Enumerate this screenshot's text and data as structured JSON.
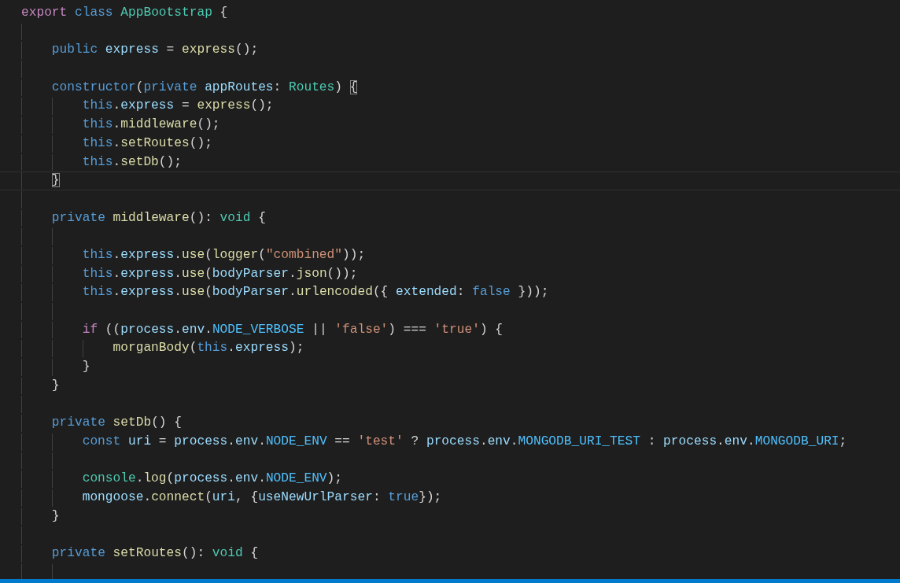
{
  "editor": {
    "lines": [
      {
        "kind": "code",
        "tokens": [
          {
            "kind": "control",
            "text": "export "
          },
          {
            "kind": "keyword",
            "text": "class "
          },
          {
            "kind": "type",
            "text": "AppBootstrap"
          },
          {
            "kind": "plain",
            "text": " {"
          }
        ],
        "children": [
          {
            "kind": "blank"
          },
          {
            "kind": "code",
            "tokens": [
              {
                "kind": "keyword",
                "text": "public "
              },
              {
                "kind": "variable",
                "text": "express"
              },
              {
                "kind": "plain",
                "text": " = "
              },
              {
                "kind": "function",
                "text": "express"
              },
              {
                "kind": "plain",
                "text": "();"
              }
            ]
          },
          {
            "kind": "blank"
          },
          {
            "kind": "code",
            "tokens": [
              {
                "kind": "keyword",
                "text": "constructor"
              },
              {
                "kind": "plain",
                "text": "("
              },
              {
                "kind": "keyword",
                "text": "private "
              },
              {
                "kind": "variable",
                "text": "appRoutes"
              },
              {
                "kind": "plain",
                "text": ": "
              },
              {
                "kind": "type",
                "text": "Routes"
              },
              {
                "kind": "plain",
                "text": ") "
              },
              {
                "kind": "plain",
                "text": "{",
                "bracket_match": true
              }
            ],
            "children": [
              {
                "kind": "code",
                "tokens": [
                  {
                    "kind": "keyword",
                    "text": "this"
                  },
                  {
                    "kind": "plain",
                    "text": "."
                  },
                  {
                    "kind": "variable",
                    "text": "express"
                  },
                  {
                    "kind": "plain",
                    "text": " = "
                  },
                  {
                    "kind": "function",
                    "text": "express"
                  },
                  {
                    "kind": "plain",
                    "text": "();"
                  }
                ]
              },
              {
                "kind": "code",
                "tokens": [
                  {
                    "kind": "keyword",
                    "text": "this"
                  },
                  {
                    "kind": "plain",
                    "text": "."
                  },
                  {
                    "kind": "function",
                    "text": "middleware"
                  },
                  {
                    "kind": "plain",
                    "text": "();"
                  }
                ]
              },
              {
                "kind": "code",
                "tokens": [
                  {
                    "kind": "keyword",
                    "text": "this"
                  },
                  {
                    "kind": "plain",
                    "text": "."
                  },
                  {
                    "kind": "function",
                    "text": "setRoutes"
                  },
                  {
                    "kind": "plain",
                    "text": "();"
                  }
                ]
              },
              {
                "kind": "code",
                "tokens": [
                  {
                    "kind": "keyword",
                    "text": "this"
                  },
                  {
                    "kind": "plain",
                    "text": "."
                  },
                  {
                    "kind": "function",
                    "text": "setDb"
                  },
                  {
                    "kind": "plain",
                    "text": "();"
                  }
                ]
              }
            ]
          },
          {
            "kind": "code",
            "current": true,
            "tokens": [
              {
                "kind": "plain",
                "text": "}",
                "bracket_match": true
              }
            ]
          },
          {
            "kind": "blank"
          },
          {
            "kind": "code",
            "tokens": [
              {
                "kind": "keyword",
                "text": "private "
              },
              {
                "kind": "function",
                "text": "middleware"
              },
              {
                "kind": "plain",
                "text": "(): "
              },
              {
                "kind": "type",
                "text": "void"
              },
              {
                "kind": "plain",
                "text": " {"
              }
            ],
            "children": [
              {
                "kind": "blank"
              },
              {
                "kind": "code",
                "tokens": [
                  {
                    "kind": "keyword",
                    "text": "this"
                  },
                  {
                    "kind": "plain",
                    "text": "."
                  },
                  {
                    "kind": "variable",
                    "text": "express"
                  },
                  {
                    "kind": "plain",
                    "text": "."
                  },
                  {
                    "kind": "function",
                    "text": "use"
                  },
                  {
                    "kind": "plain",
                    "text": "("
                  },
                  {
                    "kind": "function",
                    "text": "logger"
                  },
                  {
                    "kind": "plain",
                    "text": "("
                  },
                  {
                    "kind": "string",
                    "text": "\"combined\""
                  },
                  {
                    "kind": "plain",
                    "text": "));"
                  }
                ]
              },
              {
                "kind": "code",
                "tokens": [
                  {
                    "kind": "keyword",
                    "text": "this"
                  },
                  {
                    "kind": "plain",
                    "text": "."
                  },
                  {
                    "kind": "variable",
                    "text": "express"
                  },
                  {
                    "kind": "plain",
                    "text": "."
                  },
                  {
                    "kind": "function",
                    "text": "use"
                  },
                  {
                    "kind": "plain",
                    "text": "("
                  },
                  {
                    "kind": "variable",
                    "text": "bodyParser"
                  },
                  {
                    "kind": "plain",
                    "text": "."
                  },
                  {
                    "kind": "function",
                    "text": "json"
                  },
                  {
                    "kind": "plain",
                    "text": "());"
                  }
                ]
              },
              {
                "kind": "code",
                "tokens": [
                  {
                    "kind": "keyword",
                    "text": "this"
                  },
                  {
                    "kind": "plain",
                    "text": "."
                  },
                  {
                    "kind": "variable",
                    "text": "express"
                  },
                  {
                    "kind": "plain",
                    "text": "."
                  },
                  {
                    "kind": "function",
                    "text": "use"
                  },
                  {
                    "kind": "plain",
                    "text": "("
                  },
                  {
                    "kind": "variable",
                    "text": "bodyParser"
                  },
                  {
                    "kind": "plain",
                    "text": "."
                  },
                  {
                    "kind": "function",
                    "text": "urlencoded"
                  },
                  {
                    "kind": "plain",
                    "text": "({ "
                  },
                  {
                    "kind": "variable",
                    "text": "extended"
                  },
                  {
                    "kind": "plain",
                    "text": ": "
                  },
                  {
                    "kind": "keyword",
                    "text": "false"
                  },
                  {
                    "kind": "plain",
                    "text": " }));"
                  }
                ]
              },
              {
                "kind": "blank"
              },
              {
                "kind": "code",
                "tokens": [
                  {
                    "kind": "control",
                    "text": "if"
                  },
                  {
                    "kind": "plain",
                    "text": " (("
                  },
                  {
                    "kind": "variable",
                    "text": "process"
                  },
                  {
                    "kind": "plain",
                    "text": "."
                  },
                  {
                    "kind": "variable",
                    "text": "env"
                  },
                  {
                    "kind": "plain",
                    "text": "."
                  },
                  {
                    "kind": "constant",
                    "text": "NODE_VERBOSE"
                  },
                  {
                    "kind": "plain",
                    "text": " || "
                  },
                  {
                    "kind": "string",
                    "text": "'false'"
                  },
                  {
                    "kind": "plain",
                    "text": ") === "
                  },
                  {
                    "kind": "string",
                    "text": "'true'"
                  },
                  {
                    "kind": "plain",
                    "text": ") {"
                  }
                ],
                "children": [
                  {
                    "kind": "code",
                    "tokens": [
                      {
                        "kind": "function",
                        "text": "morganBody"
                      },
                      {
                        "kind": "plain",
                        "text": "("
                      },
                      {
                        "kind": "keyword",
                        "text": "this"
                      },
                      {
                        "kind": "plain",
                        "text": "."
                      },
                      {
                        "kind": "variable",
                        "text": "express"
                      },
                      {
                        "kind": "plain",
                        "text": ");"
                      }
                    ]
                  }
                ]
              },
              {
                "kind": "code",
                "tokens": [
                  {
                    "kind": "plain",
                    "text": "}"
                  }
                ]
              }
            ]
          },
          {
            "kind": "code",
            "tokens": [
              {
                "kind": "plain",
                "text": "}"
              }
            ]
          },
          {
            "kind": "blank"
          },
          {
            "kind": "code",
            "tokens": [
              {
                "kind": "keyword",
                "text": "private "
              },
              {
                "kind": "function",
                "text": "setDb"
              },
              {
                "kind": "plain",
                "text": "() {"
              }
            ],
            "children": [
              {
                "kind": "code",
                "tokens": [
                  {
                    "kind": "keyword",
                    "text": "const "
                  },
                  {
                    "kind": "variable",
                    "text": "uri"
                  },
                  {
                    "kind": "plain",
                    "text": " = "
                  },
                  {
                    "kind": "variable",
                    "text": "process"
                  },
                  {
                    "kind": "plain",
                    "text": "."
                  },
                  {
                    "kind": "variable",
                    "text": "env"
                  },
                  {
                    "kind": "plain",
                    "text": "."
                  },
                  {
                    "kind": "constant",
                    "text": "NODE_ENV"
                  },
                  {
                    "kind": "plain",
                    "text": " == "
                  },
                  {
                    "kind": "string",
                    "text": "'test'"
                  },
                  {
                    "kind": "plain",
                    "text": " ? "
                  },
                  {
                    "kind": "variable",
                    "text": "process"
                  },
                  {
                    "kind": "plain",
                    "text": "."
                  },
                  {
                    "kind": "variable",
                    "text": "env"
                  },
                  {
                    "kind": "plain",
                    "text": "."
                  },
                  {
                    "kind": "constant",
                    "text": "MONGODB_URI_TEST"
                  },
                  {
                    "kind": "plain",
                    "text": " : "
                  },
                  {
                    "kind": "variable",
                    "text": "process"
                  },
                  {
                    "kind": "plain",
                    "text": "."
                  },
                  {
                    "kind": "variable",
                    "text": "env"
                  },
                  {
                    "kind": "plain",
                    "text": "."
                  },
                  {
                    "kind": "constant",
                    "text": "MONGODB_URI"
                  },
                  {
                    "kind": "plain",
                    "text": ";"
                  }
                ]
              },
              {
                "kind": "blank"
              },
              {
                "kind": "code",
                "tokens": [
                  {
                    "kind": "type",
                    "text": "console"
                  },
                  {
                    "kind": "plain",
                    "text": "."
                  },
                  {
                    "kind": "function",
                    "text": "log"
                  },
                  {
                    "kind": "plain",
                    "text": "("
                  },
                  {
                    "kind": "variable",
                    "text": "process"
                  },
                  {
                    "kind": "plain",
                    "text": "."
                  },
                  {
                    "kind": "variable",
                    "text": "env"
                  },
                  {
                    "kind": "plain",
                    "text": "."
                  },
                  {
                    "kind": "constant",
                    "text": "NODE_ENV"
                  },
                  {
                    "kind": "plain",
                    "text": ");"
                  }
                ]
              },
              {
                "kind": "code",
                "tokens": [
                  {
                    "kind": "variable",
                    "text": "mongoose"
                  },
                  {
                    "kind": "plain",
                    "text": "."
                  },
                  {
                    "kind": "function",
                    "text": "connect"
                  },
                  {
                    "kind": "plain",
                    "text": "("
                  },
                  {
                    "kind": "variable",
                    "text": "uri"
                  },
                  {
                    "kind": "plain",
                    "text": ", {"
                  },
                  {
                    "kind": "variable",
                    "text": "useNewUrlParser"
                  },
                  {
                    "kind": "plain",
                    "text": ": "
                  },
                  {
                    "kind": "keyword",
                    "text": "true"
                  },
                  {
                    "kind": "plain",
                    "text": "});"
                  }
                ]
              }
            ]
          },
          {
            "kind": "code",
            "tokens": [
              {
                "kind": "plain",
                "text": "}"
              }
            ]
          },
          {
            "kind": "blank"
          },
          {
            "kind": "code",
            "tokens": [
              {
                "kind": "keyword",
                "text": "private "
              },
              {
                "kind": "function",
                "text": "setRoutes"
              },
              {
                "kind": "plain",
                "text": "(): "
              },
              {
                "kind": "type",
                "text": "void"
              },
              {
                "kind": "plain",
                "text": " {"
              }
            ],
            "children": [
              {
                "kind": "blank"
              }
            ]
          }
        ]
      }
    ]
  }
}
